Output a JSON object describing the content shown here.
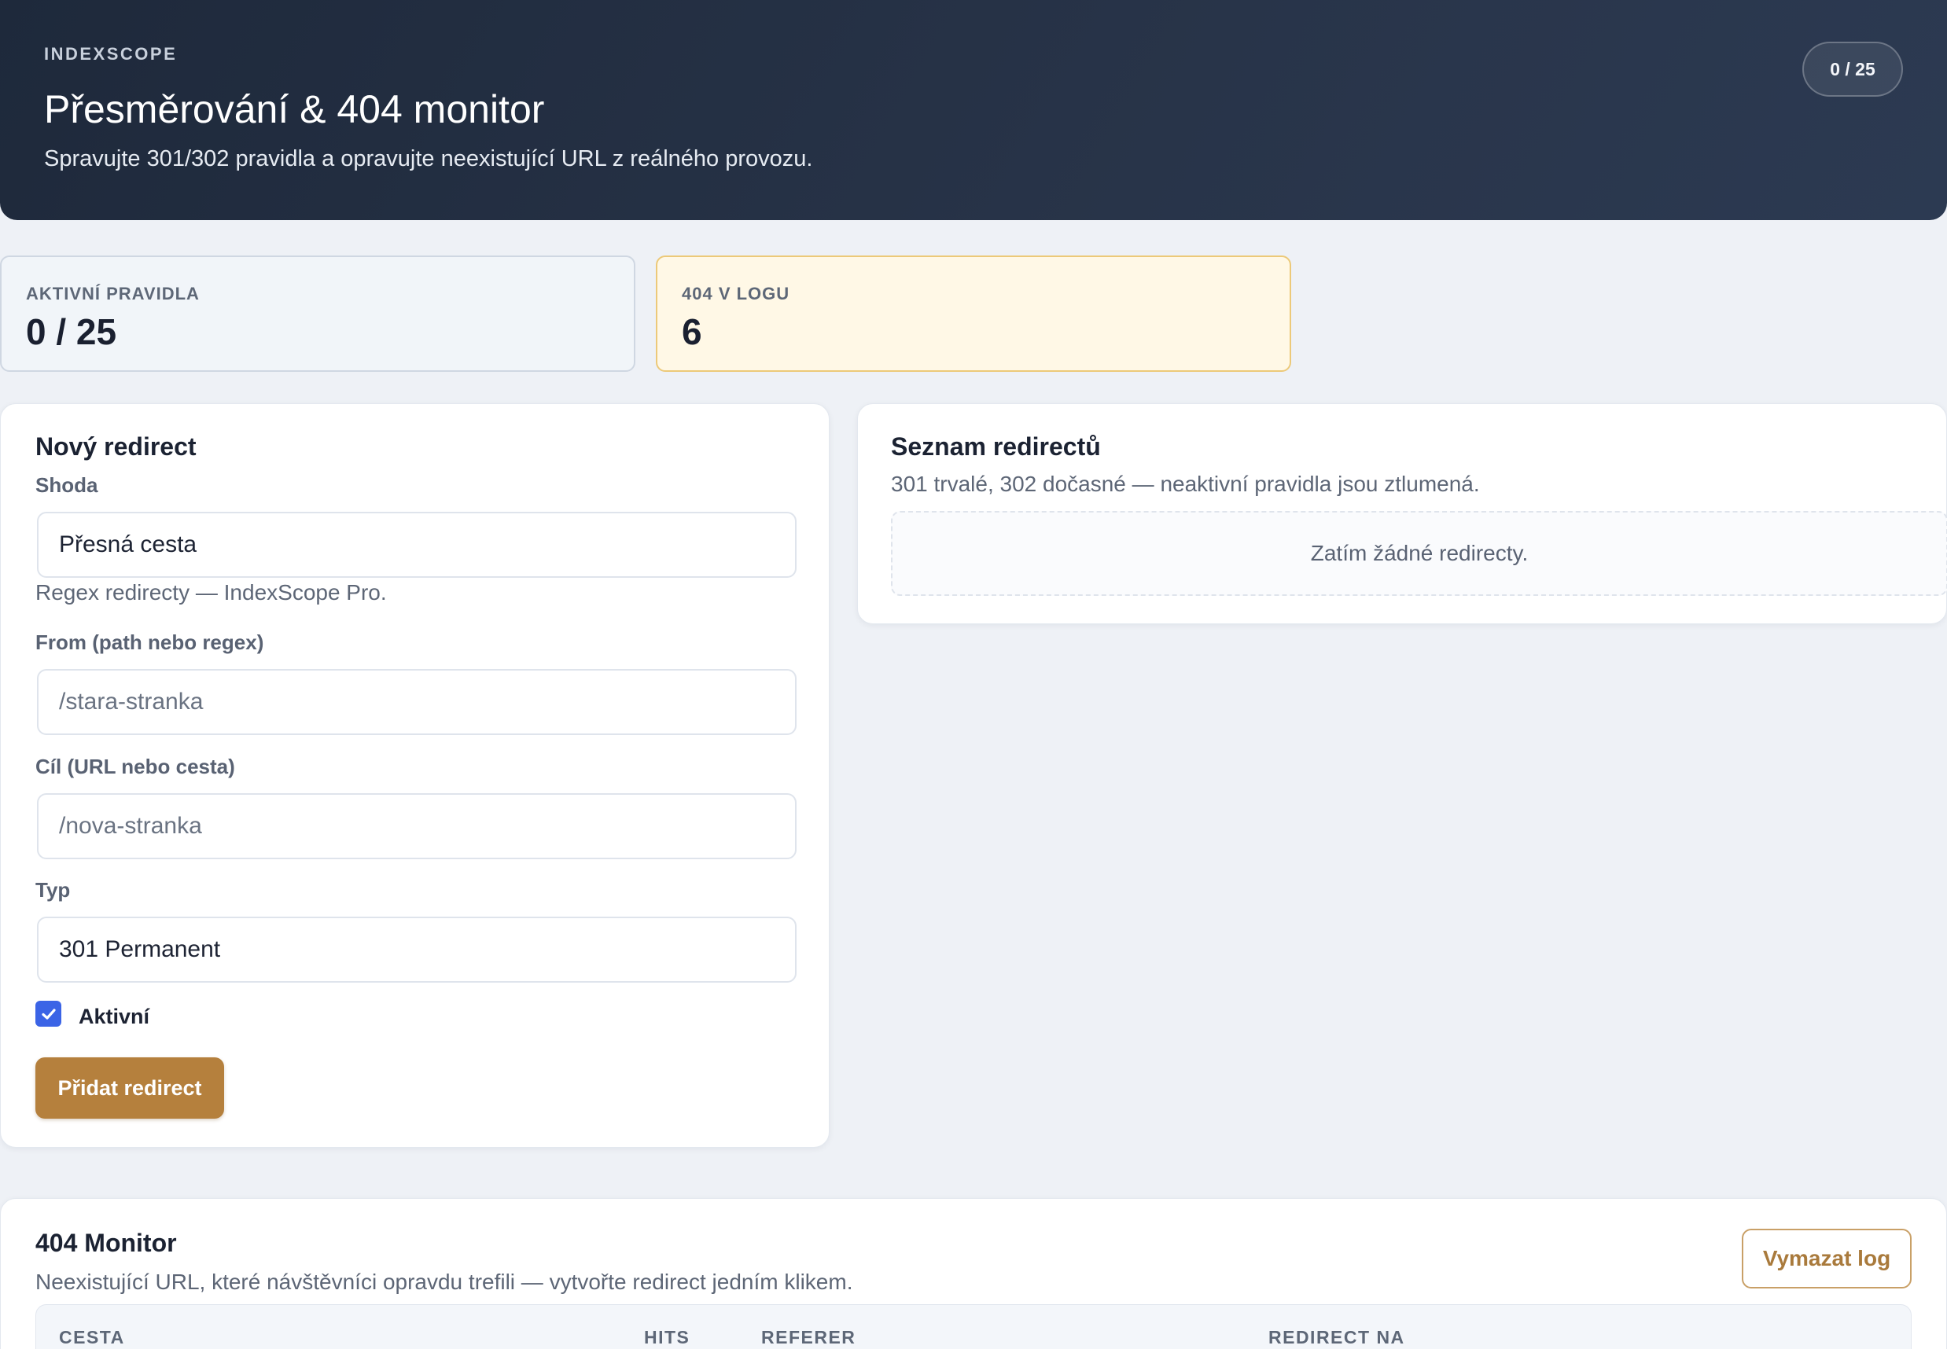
{
  "header": {
    "eyebrow": "INDEXSCOPE",
    "title": "Přesměrování & 404 monitor",
    "subtitle": "Spravujte 301/302 pravidla a opravujte neexistující URL z reálného provozu.",
    "badge": "0 / 25"
  },
  "stats": [
    {
      "label": "AKTIVNÍ PRAVIDLA",
      "value": "0 / 25"
    },
    {
      "label": "404 V LOGU",
      "value": "6"
    }
  ],
  "new_redirect": {
    "title": "Nový redirect",
    "match_label": "Shoda",
    "match_value": "Přesná cesta",
    "match_hint": "Regex redirecty — IndexScope Pro.",
    "from_label": "From (path nebo regex)",
    "from_placeholder": "/stara-stranka",
    "to_label": "Cíl (URL nebo cesta)",
    "to_placeholder": "/nova-stranka",
    "type_label": "Typ",
    "type_value": "301 Permanent",
    "active_label": "Aktivní",
    "active_checked": true,
    "submit_label": "Přidat redirect"
  },
  "redirect_list": {
    "title": "Seznam redirectů",
    "description": "301 trvalé, 302 dočasné — neaktivní pravidla jsou ztlumená.",
    "empty_text": "Zatím žádné redirecty."
  },
  "monitor": {
    "title": "404 Monitor",
    "description": "Neexistující URL, které návštěvníci opravdu trefili — vytvořte redirect jedním klikem.",
    "clear_label": "Vymazat log",
    "columns": [
      "CESTA",
      "HITS",
      "REFERER",
      "REDIRECT NA"
    ]
  },
  "colors": {
    "accent": "#b5803d",
    "checkbox": "#3b64e6",
    "warn_bg": "#fff8e6",
    "hero_bg": "#1e293b"
  }
}
